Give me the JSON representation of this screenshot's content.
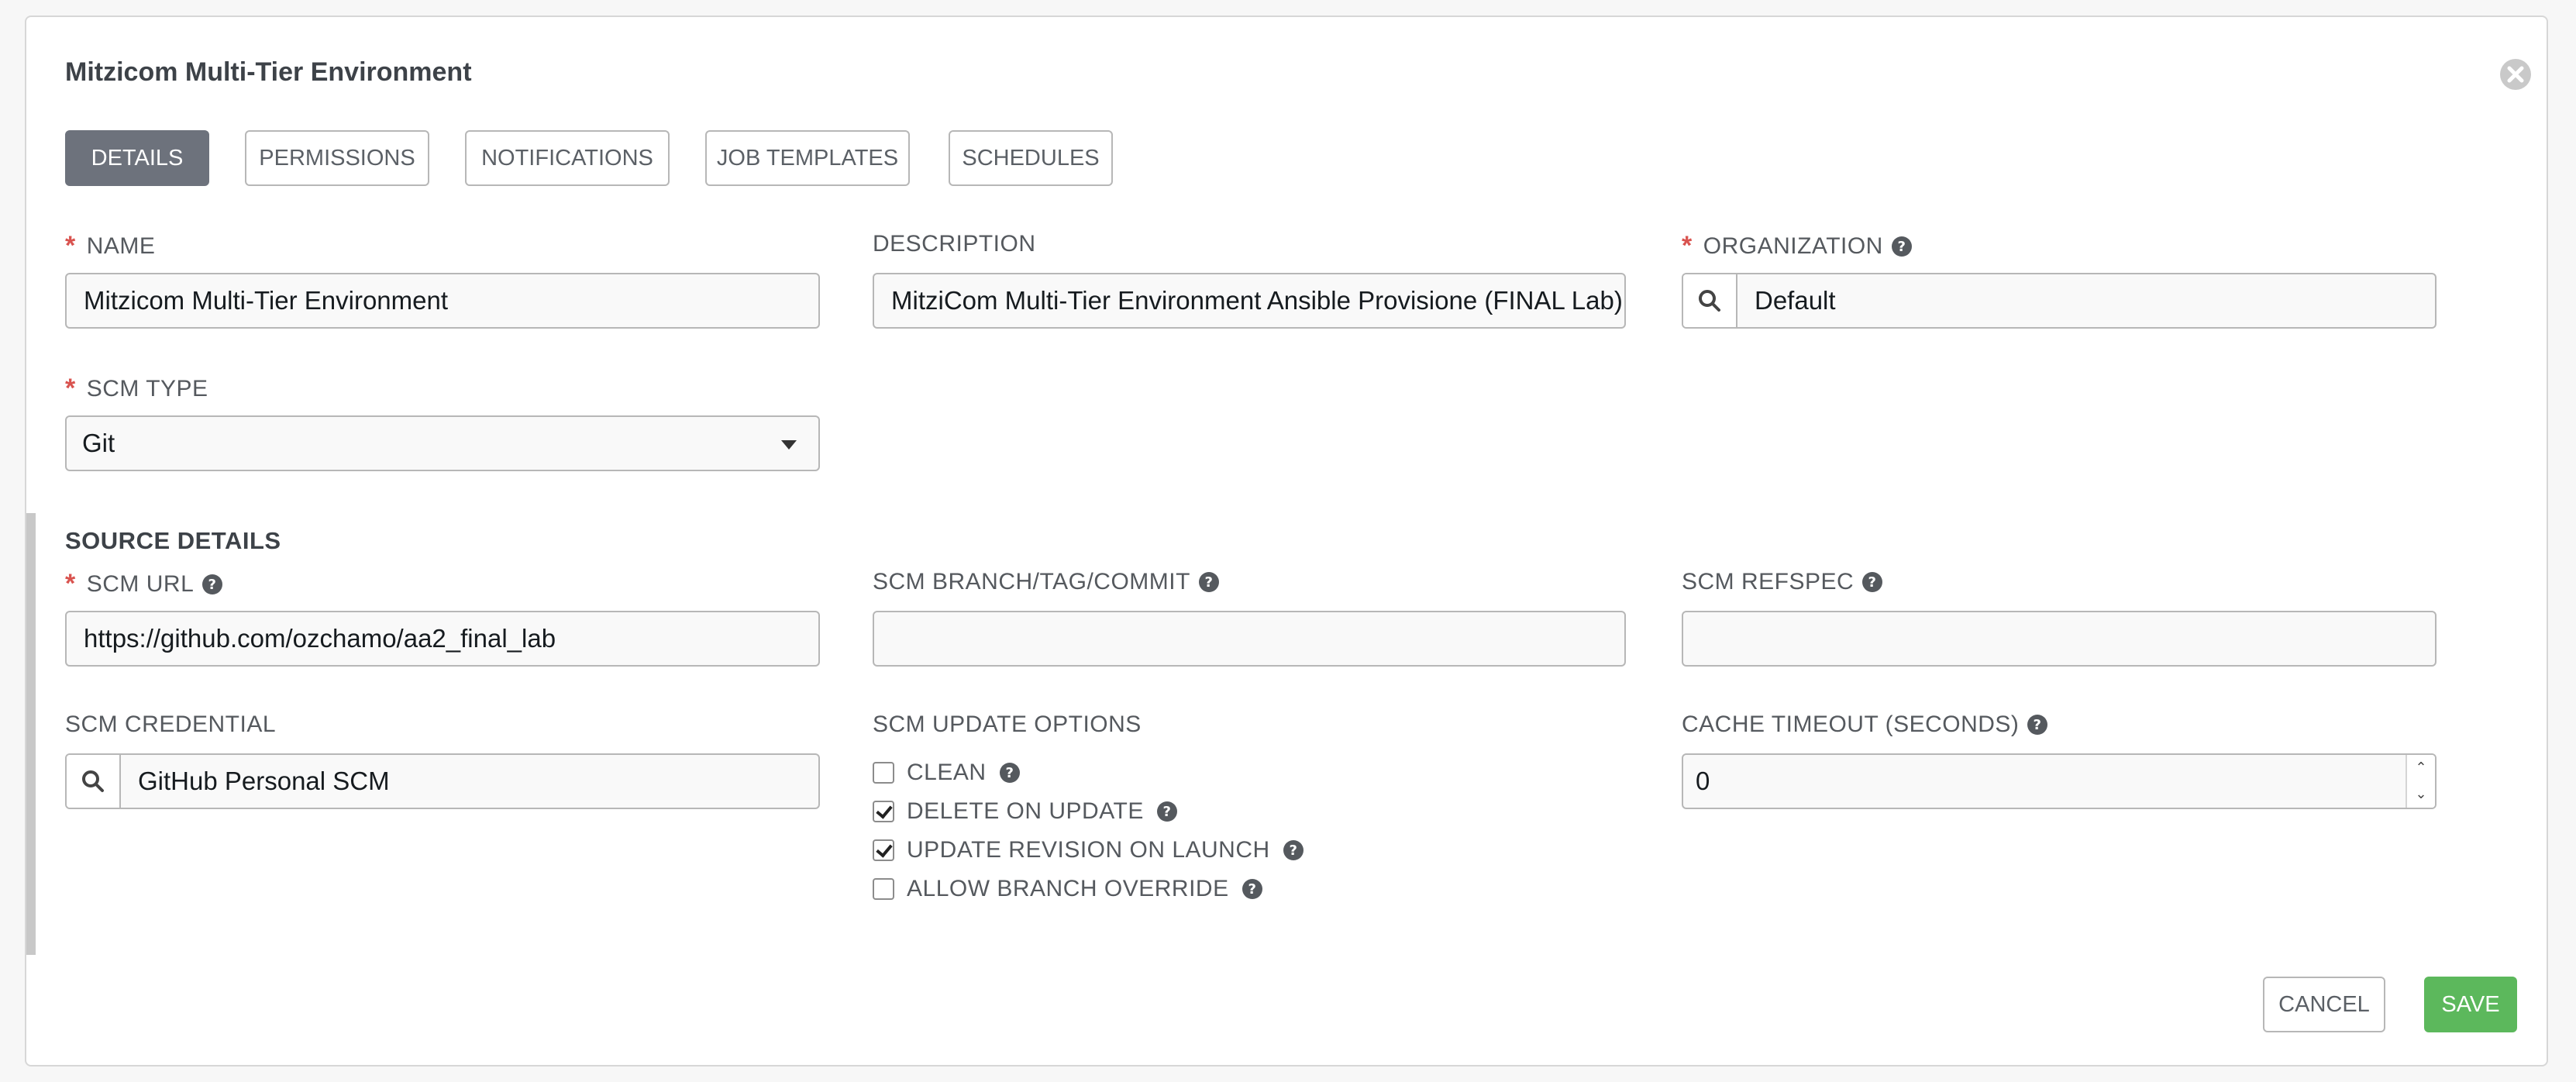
{
  "form": {
    "title": "Mitzicom Multi-Tier Environment",
    "tabs": [
      {
        "label": "DETAILS",
        "active": true
      },
      {
        "label": "PERMISSIONS",
        "active": false
      },
      {
        "label": "NOTIFICATIONS",
        "active": false
      },
      {
        "label": "JOB TEMPLATES",
        "active": false
      },
      {
        "label": "SCHEDULES",
        "active": false
      }
    ]
  },
  "fields": {
    "name": {
      "label": "NAME",
      "value": "Mitzicom Multi-Tier Environment",
      "required": true
    },
    "description": {
      "label": "DESCRIPTION",
      "value": "MitziCom  Multi-Tier Environment Ansible Provisione (FINAL Lab)"
    },
    "organization": {
      "label": "ORGANIZATION",
      "value": "Default",
      "required": true
    },
    "scm_type": {
      "label": "SCM TYPE",
      "value": "Git",
      "required": true
    }
  },
  "source_details": {
    "title": "SOURCE DETAILS",
    "scm_url": {
      "label": "SCM URL",
      "value": "https://github.com/ozchamo/aa2_final_lab",
      "required": true
    },
    "scm_branch": {
      "label": "SCM BRANCH/TAG/COMMIT",
      "value": ""
    },
    "scm_refspec": {
      "label": "SCM REFSPEC",
      "value": ""
    },
    "scm_credential": {
      "label": "SCM CREDENTIAL",
      "value": "GitHub Personal SCM"
    },
    "update_options": {
      "label": "SCM UPDATE OPTIONS",
      "options": [
        {
          "label": "CLEAN",
          "checked": false
        },
        {
          "label": "DELETE ON UPDATE",
          "checked": true
        },
        {
          "label": "UPDATE REVISION ON LAUNCH",
          "checked": true
        },
        {
          "label": "ALLOW BRANCH OVERRIDE",
          "checked": false
        }
      ]
    },
    "cache_timeout": {
      "label": "CACHE TIMEOUT (SECONDS)",
      "value": "0"
    }
  },
  "actions": {
    "cancel_label": "CANCEL",
    "save_label": "SAVE"
  },
  "colors": {
    "accent_save": "#5cb85c",
    "active_tab": "#6d727c",
    "required": "#d9534f"
  },
  "icons": {
    "close": "close-circle-icon",
    "help": "question-circle-icon",
    "lookup": "search-icon",
    "dropdown": "caret-down-icon"
  }
}
